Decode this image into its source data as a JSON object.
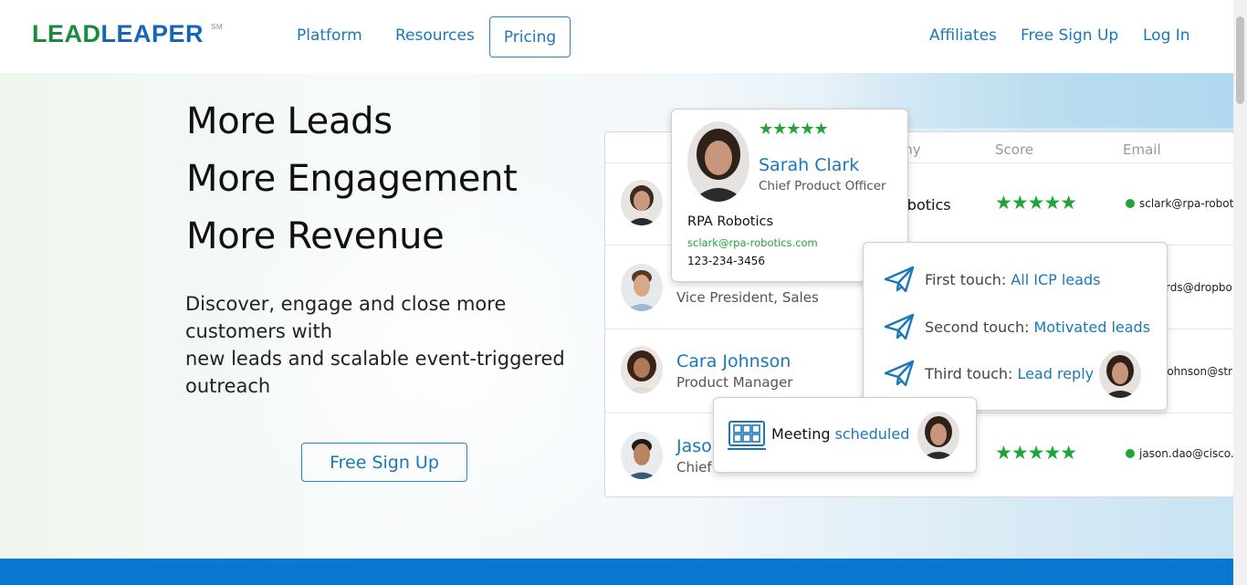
{
  "brand": {
    "part1": "LEAD",
    "part2": "LEAPER",
    "mark": "SM"
  },
  "nav": {
    "platform": "Platform",
    "resources": "Resources",
    "pricing": "Pricing",
    "affiliates": "Affiliates",
    "signup": "Free Sign Up",
    "login": "Log In"
  },
  "hero": {
    "headline1": "More Leads",
    "headline2": "More Engagement",
    "headline3": "More Revenue",
    "sub_line1": "Discover, engage and close more customers with",
    "sub_line2": "new leads and scalable event-triggered outreach",
    "cta": "Free Sign Up"
  },
  "table": {
    "headers": {
      "company": "any",
      "score": "Score",
      "email": "Email"
    },
    "rows": [
      {
        "company": "obotics",
        "stars": "★★★★★",
        "email": "sclark@rpa-roboti"
      },
      {
        "title": "Vice President, Sales",
        "email": "rds@dropbo"
      },
      {
        "name": "Cara Johnson",
        "title": "Product Manager",
        "email": "johnson@stri"
      },
      {
        "name": "Jaso",
        "title": "Chief",
        "stars": "★★★★★",
        "email": "jason.dao@cisco.c"
      }
    ]
  },
  "profile": {
    "stars": "★★★★★",
    "name": "Sarah Clark",
    "title": "Chief Product Officer",
    "company": "RPA Robotics",
    "email": "sclark@rpa-robotics.com",
    "phone": "123-234-3456"
  },
  "sequence": [
    {
      "label": "First touch:",
      "value": "All ICP leads"
    },
    {
      "label": "Second touch:",
      "value": "Motivated leads"
    },
    {
      "label": "Third touch:",
      "value": "Lead reply"
    }
  ],
  "meeting": {
    "label": "Meeting",
    "value": "scheduled"
  },
  "colors": {
    "green": "#1a8a3e",
    "blue": "#1a78b8",
    "band": "#0a78d0",
    "star": "#22a33a"
  }
}
